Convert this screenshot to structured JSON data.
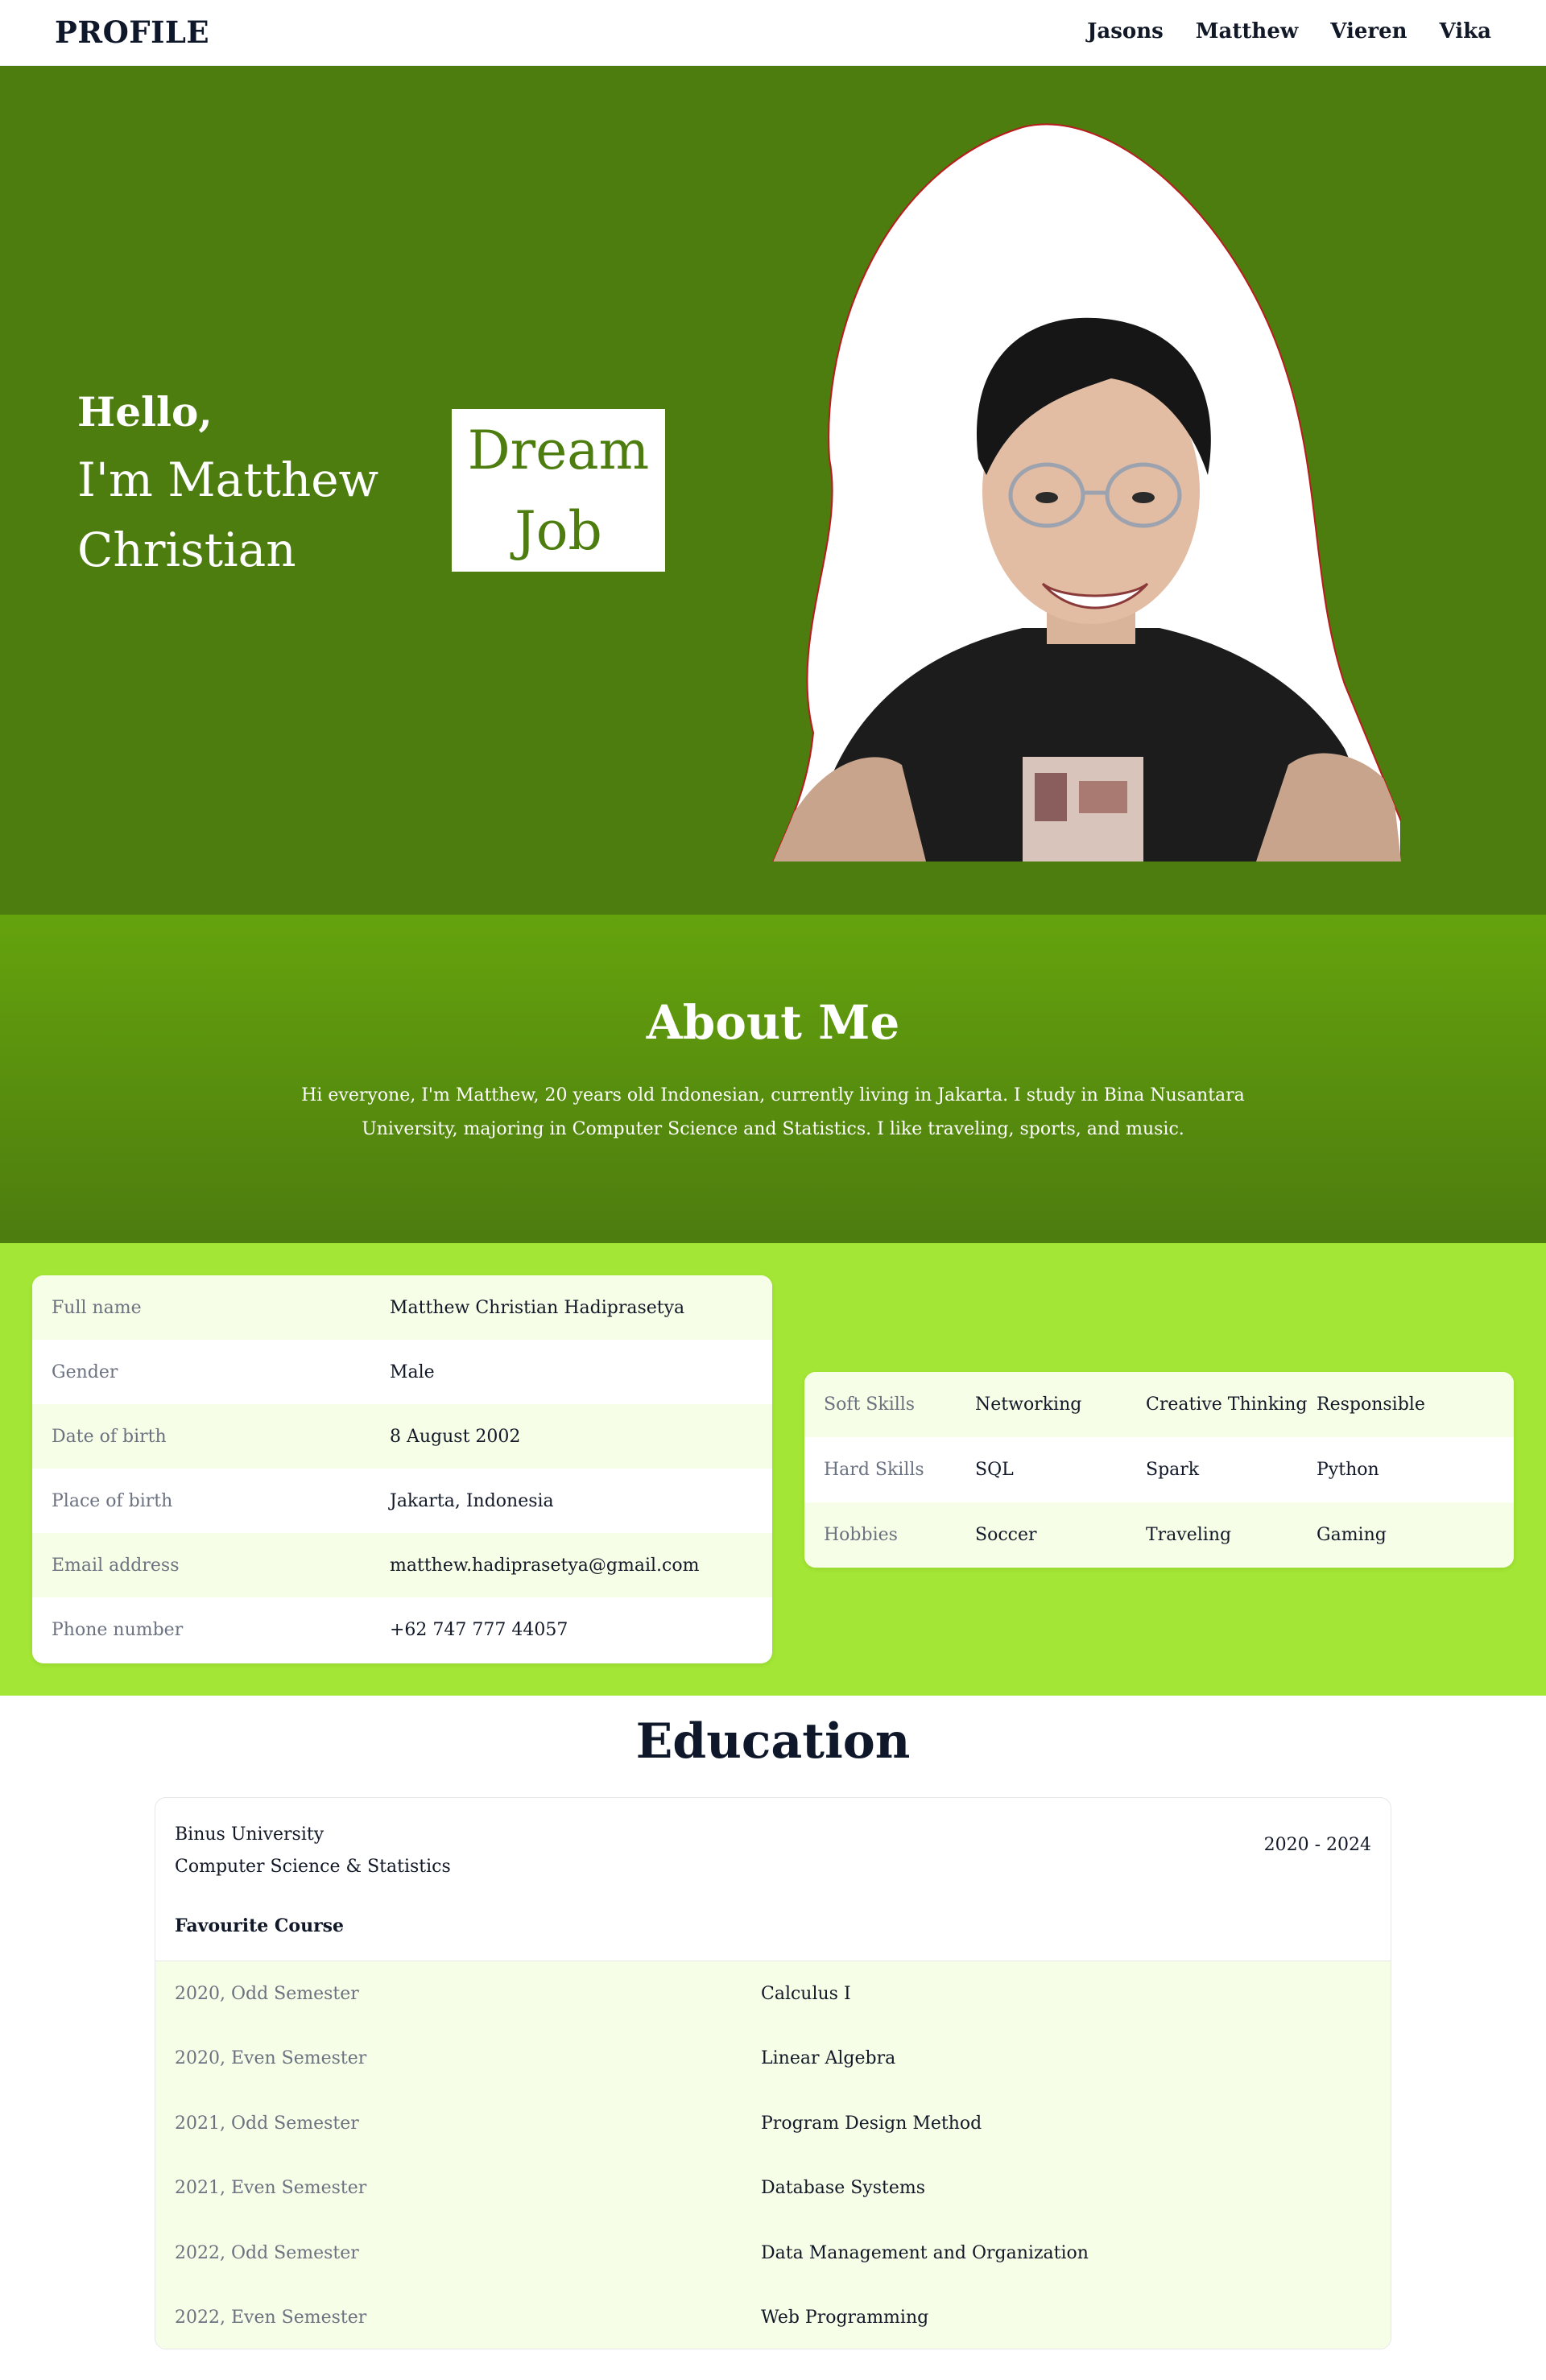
{
  "nav": {
    "brand": "PROFILE",
    "links": [
      "Jasons",
      "Matthew",
      "Vieren",
      "Vika"
    ]
  },
  "hero": {
    "greeting": "Hello,",
    "name_line1": "I'm Matthew",
    "name_line2": "Christian",
    "badge_line1": "Dream",
    "badge_line2": "Job",
    "photo_icon": "profile-photo"
  },
  "about": {
    "title": "About Me",
    "text": "Hi everyone, I'm Matthew, 20 years old Indonesian, currently living in Jakarta. I study in Bina Nusantara University, majoring in Computer Science and Statistics. I like traveling, sports, and music."
  },
  "personal": [
    {
      "label": "Full name",
      "value": "Matthew Christian Hadiprasetya"
    },
    {
      "label": "Gender",
      "value": "Male"
    },
    {
      "label": "Date of birth",
      "value": "8 August 2002"
    },
    {
      "label": "Place of birth",
      "value": "Jakarta, Indonesia"
    },
    {
      "label": "Email address",
      "value": "matthew.hadiprasetya@gmail.com"
    },
    {
      "label": "Phone number",
      "value": "+62 747 777 44057"
    }
  ],
  "skills": [
    {
      "label": "Soft Skills",
      "items": [
        "Networking",
        "Creative Thinking",
        "Responsible"
      ]
    },
    {
      "label": "Hard Skills",
      "items": [
        "SQL",
        "Spark",
        "Python"
      ]
    },
    {
      "label": "Hobbies",
      "items": [
        "Soccer",
        "Traveling",
        "Gaming"
      ]
    }
  ],
  "education": {
    "title": "Education",
    "university": "Binus University",
    "major": "Computer Science & Statistics",
    "years": "2020 - 2024",
    "fav_title": "Favourite Course",
    "courses": [
      {
        "semester": "2020, Odd Semester",
        "course": "Calculus I"
      },
      {
        "semester": "2020, Even Semester",
        "course": "Linear Algebra"
      },
      {
        "semester": "2021, Odd Semester",
        "course": "Program Design Method"
      },
      {
        "semester": "2021, Even Semester",
        "course": "Database Systems"
      },
      {
        "semester": "2022, Odd Semester",
        "course": "Data Management and Organization"
      },
      {
        "semester": "2022, Even Semester",
        "course": "Web Programming"
      }
    ]
  },
  "colors": {
    "hero_bg": "#4d7c0f",
    "about_bg": "#65a30d",
    "band_bg": "#a3e635",
    "row_alt": "#f7fee7"
  }
}
